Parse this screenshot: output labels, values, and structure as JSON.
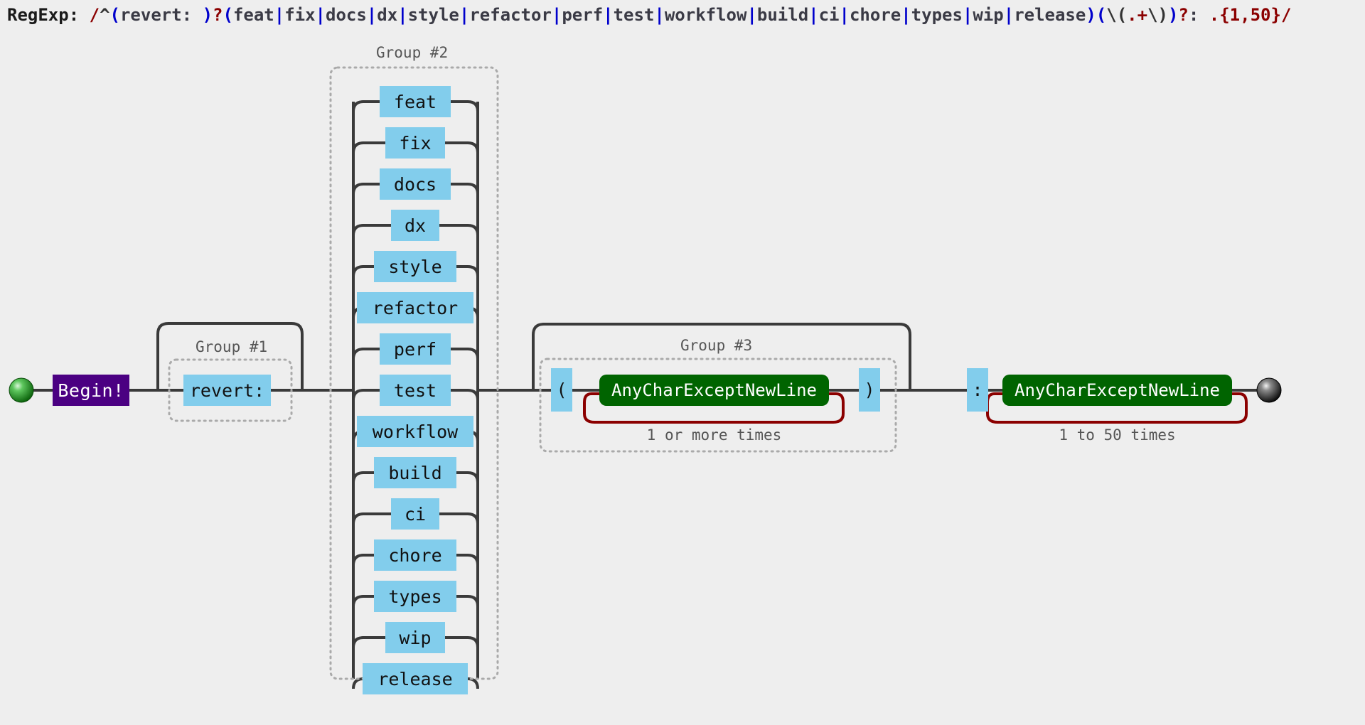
{
  "header": {
    "label": "RegExp:",
    "pattern": "/^(revert: )?(feat|fix|docs|dx|style|refactor|perf|test|workflow|build|ci|chore|types|wip|release)(\\(.+\\))?: .{1,50}/",
    "tokens": [
      {
        "t": "RegExp:",
        "c": "lbl"
      },
      {
        "t": " ",
        "c": "lbl"
      },
      {
        "t": "/",
        "c": "slash"
      },
      {
        "t": "^",
        "c": "anchor"
      },
      {
        "t": "(",
        "c": "paren"
      },
      {
        "t": "revert:",
        "c": "lit"
      },
      {
        "t": " ",
        "c": "lit"
      },
      {
        "t": ")",
        "c": "paren"
      },
      {
        "t": "?",
        "c": "quant"
      },
      {
        "t": "(",
        "c": "paren"
      },
      {
        "t": "feat",
        "c": "lit"
      },
      {
        "t": "|",
        "c": "pipe"
      },
      {
        "t": "fix",
        "c": "lit"
      },
      {
        "t": "|",
        "c": "pipe"
      },
      {
        "t": "docs",
        "c": "lit"
      },
      {
        "t": "|",
        "c": "pipe"
      },
      {
        "t": "dx",
        "c": "lit"
      },
      {
        "t": "|",
        "c": "pipe"
      },
      {
        "t": "style",
        "c": "lit"
      },
      {
        "t": "|",
        "c": "pipe"
      },
      {
        "t": "refactor",
        "c": "lit"
      },
      {
        "t": "|",
        "c": "pipe"
      },
      {
        "t": "perf",
        "c": "lit"
      },
      {
        "t": "|",
        "c": "pipe"
      },
      {
        "t": "test",
        "c": "lit"
      },
      {
        "t": "|",
        "c": "pipe"
      },
      {
        "t": "workflow",
        "c": "lit"
      },
      {
        "t": "|",
        "c": "pipe"
      },
      {
        "t": "build",
        "c": "lit"
      },
      {
        "t": "|",
        "c": "pipe"
      },
      {
        "t": "ci",
        "c": "lit"
      },
      {
        "t": "|",
        "c": "pipe"
      },
      {
        "t": "chore",
        "c": "lit"
      },
      {
        "t": "|",
        "c": "pipe"
      },
      {
        "t": "types",
        "c": "lit"
      },
      {
        "t": "|",
        "c": "pipe"
      },
      {
        "t": "wip",
        "c": "lit"
      },
      {
        "t": "|",
        "c": "pipe"
      },
      {
        "t": "release",
        "c": "lit"
      },
      {
        "t": ")",
        "c": "paren"
      },
      {
        "t": "(",
        "c": "paren"
      },
      {
        "t": "\\(",
        "c": "esc"
      },
      {
        "t": ".",
        "c": "dot"
      },
      {
        "t": "+",
        "c": "quant"
      },
      {
        "t": "\\)",
        "c": "esc"
      },
      {
        "t": ")",
        "c": "paren"
      },
      {
        "t": "?",
        "c": "quant"
      },
      {
        "t": ":",
        "c": "lit"
      },
      {
        "t": " ",
        "c": "lit"
      },
      {
        "t": ".",
        "c": "dot"
      },
      {
        "t": "{1,50}",
        "c": "quant"
      },
      {
        "t": "/",
        "c": "slash"
      }
    ]
  },
  "diagram": {
    "start_node": "start-circle",
    "end_node": "end-circle",
    "begin_label": "Begin!",
    "group1": {
      "title": "Group #2",
      "name": "Group #1",
      "label": "Group #1",
      "content": "revert:"
    },
    "group2": {
      "label": "Group #2",
      "alternatives": [
        "feat",
        "fix",
        "docs",
        "dx",
        "style",
        "refactor",
        "perf",
        "test",
        "workflow",
        "build",
        "ci",
        "chore",
        "types",
        "wip",
        "release"
      ]
    },
    "group3": {
      "label": "Group #3",
      "open_paren": "(",
      "close_paren": ")",
      "charclass": "AnyCharExceptNewLine",
      "quantifier": "1 or more times"
    },
    "tail": {
      "colon": ":",
      "charclass": "AnyCharExceptNewLine",
      "quantifier": "1 to 50 times"
    }
  },
  "colors": {
    "background": "#eeeeee",
    "literal_box": "#82cdec",
    "begin_box": "#4B0082",
    "charclass_box": "#006400",
    "quantifier_arc": "#8B0000",
    "line": "#3a3a3a",
    "group_dash": "#aaaaaa",
    "start_circle": "#2a9a2a",
    "end_circle": "#222222"
  }
}
